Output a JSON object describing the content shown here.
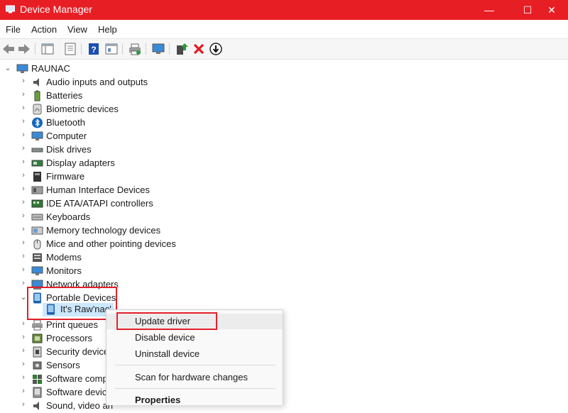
{
  "window": {
    "title": "Device Manager",
    "minimize": "—",
    "maximize": "☐",
    "close": "✕",
    "accent": "#e81e25"
  },
  "menu": {
    "file": "File",
    "action": "Action",
    "view": "View",
    "help": "Help"
  },
  "tree": {
    "root": "RAUNAC",
    "categories": [
      {
        "label": "Audio inputs and outputs",
        "icon": "speaker-icon"
      },
      {
        "label": "Batteries",
        "icon": "battery-icon"
      },
      {
        "label": "Biometric devices",
        "icon": "fingerprint-icon"
      },
      {
        "label": "Bluetooth",
        "icon": "bluetooth-icon"
      },
      {
        "label": "Computer",
        "icon": "monitor-icon"
      },
      {
        "label": "Disk drives",
        "icon": "disk-drive-icon"
      },
      {
        "label": "Display adapters",
        "icon": "display-adapter-icon"
      },
      {
        "label": "Firmware",
        "icon": "firmware-icon"
      },
      {
        "label": "Human Interface Devices",
        "icon": "hid-icon"
      },
      {
        "label": "IDE ATA/ATAPI controllers",
        "icon": "ide-controller-icon"
      },
      {
        "label": "Keyboards",
        "icon": "keyboard-icon"
      },
      {
        "label": "Memory technology devices",
        "icon": "memory-icon"
      },
      {
        "label": "Mice and other pointing devices",
        "icon": "mouse-icon"
      },
      {
        "label": "Modems",
        "icon": "modem-icon"
      },
      {
        "label": "Monitors",
        "icon": "monitor-icon"
      },
      {
        "label": "Network adapters",
        "icon": "network-adapter-icon"
      },
      {
        "label": "Portable Devices",
        "icon": "portable-device-icon"
      },
      {
        "label": "Print queues",
        "icon": "printer-icon"
      },
      {
        "label": "Processors",
        "icon": "processor-icon"
      },
      {
        "label": "Security devices",
        "icon": "security-device-icon"
      },
      {
        "label": "Sensors",
        "icon": "sensor-icon"
      },
      {
        "label": "Software compo",
        "icon": "software-component-icon"
      },
      {
        "label": "Software device",
        "icon": "software-device-icon"
      },
      {
        "label": "Sound, video an",
        "icon": "sound-video-icon"
      }
    ],
    "portable_child": "It's Raw'nac'",
    "highlight_color": "#e2202b"
  },
  "context_menu": {
    "update_driver": "Update driver",
    "disable_device": "Disable device",
    "uninstall_device": "Uninstall device",
    "scan_hardware": "Scan for hardware changes",
    "properties": "Properties"
  }
}
